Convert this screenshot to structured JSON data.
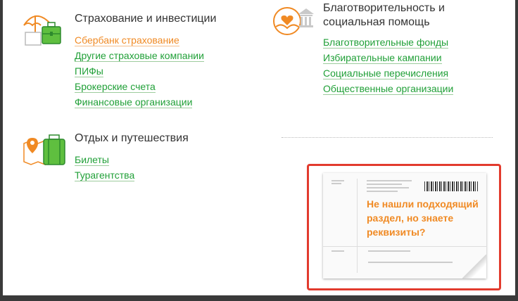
{
  "sections": {
    "insurance": {
      "title": "Страхование и инвестиции",
      "links": [
        "Сбербанк страхование",
        "Другие страховые компании",
        "ПИФы",
        "Брокерские счета",
        "Финансовые организации"
      ]
    },
    "charity": {
      "title_line1": "Благотворительность и",
      "title_line2": "социальная помощь",
      "links": [
        "Благотворительные фонды",
        "Избирательные кампании",
        "Социальные перечисления",
        "Общественные организации"
      ]
    },
    "travel": {
      "title": "Отдых и путешествия",
      "links": [
        "Билеты",
        "Турагентства"
      ]
    }
  },
  "promo": {
    "line1": "Не нашли подходящий",
    "line2": "раздел, но знаете",
    "line3": "реквизиты?"
  },
  "colors": {
    "green": "#21a038",
    "orange": "#f08a24",
    "highlight_border": "#e23b2e"
  },
  "icons": [
    "umbrella-briefcase-icon",
    "bank-heart-icon",
    "map-suitcase-icon"
  ]
}
